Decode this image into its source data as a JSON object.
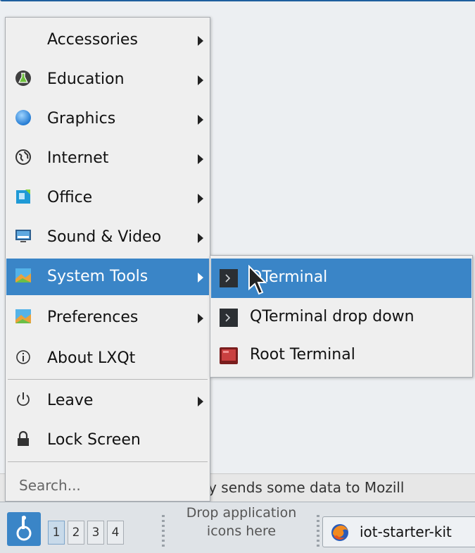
{
  "menu": {
    "items": [
      {
        "label": "Accessories",
        "icon": "none",
        "arrow": true
      },
      {
        "label": "Education",
        "icon": "flask-icon",
        "arrow": true
      },
      {
        "label": "Graphics",
        "icon": "blue-circle-icon",
        "arrow": true
      },
      {
        "label": "Internet",
        "icon": "globe-icon",
        "arrow": true
      },
      {
        "label": "Office",
        "icon": "document-icon",
        "arrow": true
      },
      {
        "label": "Sound & Video",
        "icon": "monitor-icon",
        "arrow": true
      },
      {
        "label": "System Tools",
        "icon": "landscape-icon",
        "arrow": true,
        "active": true
      },
      {
        "label": "Preferences",
        "icon": "landscape-icon",
        "arrow": true
      },
      {
        "label": "About LXQt",
        "icon": "info-icon",
        "arrow": false
      }
    ],
    "leave_label": "Leave",
    "lock_label": "Lock Screen",
    "search_placeholder": "Search..."
  },
  "submenu": {
    "items": [
      {
        "label": "QTerminal",
        "icon": "terminal-icon",
        "active": true
      },
      {
        "label": "QTerminal drop down",
        "icon": "terminal-icon"
      },
      {
        "label": "Root Terminal",
        "icon": "root-terminal-icon"
      }
    ]
  },
  "background": {
    "notification_text": "lly sends some data to Mozill"
  },
  "taskbar": {
    "desktops": [
      "1",
      "2",
      "3",
      "4"
    ],
    "drop_text_line1": "Drop application",
    "drop_text_line2": "icons here",
    "task_label": "iot-starter-kit"
  },
  "colors": {
    "accent": "#3a85c7",
    "menu_bg": "#efefef"
  }
}
